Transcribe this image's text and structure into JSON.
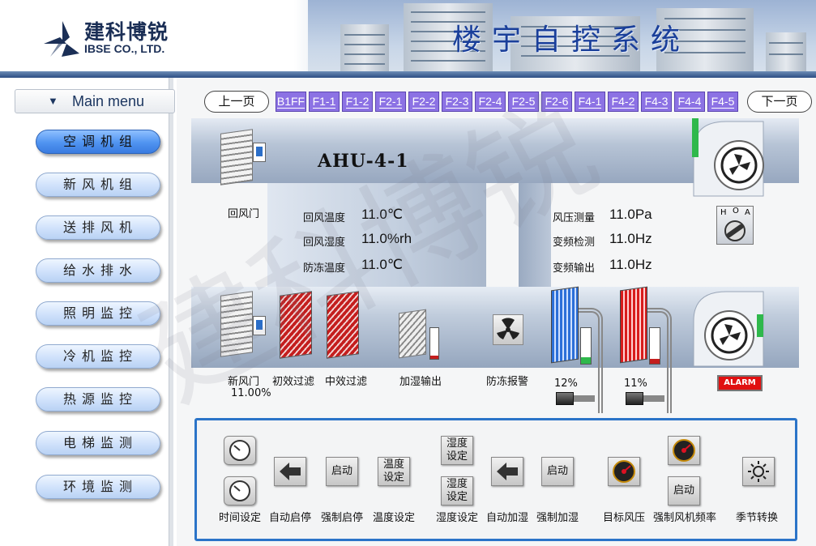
{
  "header": {
    "logo_cn": "建科博锐",
    "logo_en": "IBSE CO., LTD.",
    "title": "楼宇自控系统"
  },
  "sidebar": {
    "menu_header": "Main menu",
    "items": [
      {
        "label": "空调机组",
        "active": true
      },
      {
        "label": "新风机组",
        "active": false
      },
      {
        "label": "送排风机",
        "active": false
      },
      {
        "label": "给水排水",
        "active": false
      },
      {
        "label": "照明监控",
        "active": false
      },
      {
        "label": "冷机监控",
        "active": false
      },
      {
        "label": "热源监控",
        "active": false
      },
      {
        "label": "电梯监测",
        "active": false
      },
      {
        "label": "环境监测",
        "active": false
      }
    ]
  },
  "floorbar": {
    "prev": "上一页",
    "next": "下一页",
    "floors": [
      "B1FF",
      "F1-1",
      "F1-2",
      "F2-1",
      "F2-2",
      "F2-3",
      "F2-4",
      "F2-5",
      "F2-6",
      "F4-1",
      "F4-2",
      "F4-3",
      "F4-4",
      "F4-5"
    ]
  },
  "ahu": {
    "title": "AHU-4-1",
    "return_damper": "回风门",
    "fresh_damper": "新风门",
    "fresh_damper_value": "11.00%",
    "primary_filter": "初效过滤",
    "medium_filter": "中效过滤",
    "humidifier": "加湿输出",
    "antifreeze_alarm": "防冻报警",
    "cool_valve_pct": "12%",
    "heat_valve_pct": "11%",
    "alarm": "ALARM",
    "hoa": {
      "h": "H",
      "o": "O",
      "a": "A"
    },
    "readings_left": [
      {
        "label": "回风温度",
        "value": "11.0℃"
      },
      {
        "label": "回风湿度",
        "value": "11.0%rh"
      },
      {
        "label": "防冻温度",
        "value": "11.0℃"
      }
    ],
    "readings_right": [
      {
        "label": "风压测量",
        "value": "11.0Pa"
      },
      {
        "label": "变频检测",
        "value": "11.0Hz"
      },
      {
        "label": "变频输出",
        "value": "11.0Hz"
      }
    ]
  },
  "controls": {
    "start_btn": "启动",
    "temp_set_btn_l1": "温度",
    "temp_set_btn_l2": "设定",
    "hum_set_btn_l1": "湿度",
    "hum_set_btn_l2": "设定",
    "labels": [
      "时间设定",
      "自动启停",
      "强制启停",
      "温度设定",
      "湿度设定",
      "自动加湿",
      "强制加湿",
      "目标风压",
      "强制风机频率",
      "季节转换"
    ]
  },
  "watermark": "建科博锐",
  "colors": {
    "accent": "#2b74c8",
    "floor_tab": "#8c72e4",
    "alarm": "#e01010",
    "menu_active": "#4f93f0"
  }
}
